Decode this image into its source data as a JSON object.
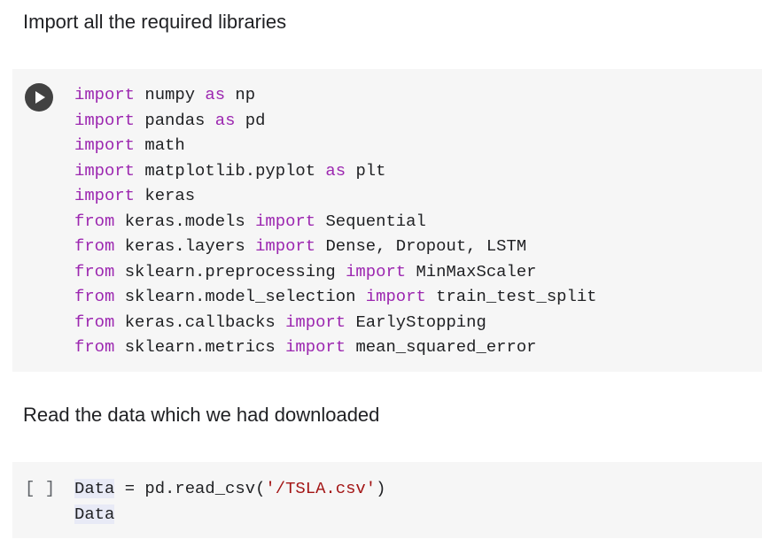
{
  "cells": {
    "text1": "Import all the required libraries",
    "code1": {
      "lines": [
        [
          {
            "t": "import",
            "k": "kw"
          },
          {
            "t": " numpy ",
            "k": "plain"
          },
          {
            "t": "as",
            "k": "kw"
          },
          {
            "t": " np",
            "k": "plain"
          }
        ],
        [
          {
            "t": "import",
            "k": "kw"
          },
          {
            "t": " pandas ",
            "k": "plain"
          },
          {
            "t": "as",
            "k": "kw"
          },
          {
            "t": " pd",
            "k": "plain"
          }
        ],
        [
          {
            "t": "import",
            "k": "kw"
          },
          {
            "t": " math",
            "k": "plain"
          }
        ],
        [
          {
            "t": "import",
            "k": "kw"
          },
          {
            "t": " matplotlib.pyplot ",
            "k": "plain"
          },
          {
            "t": "as",
            "k": "kw"
          },
          {
            "t": " plt",
            "k": "plain"
          }
        ],
        [
          {
            "t": "import",
            "k": "kw"
          },
          {
            "t": " keras",
            "k": "plain"
          }
        ],
        [
          {
            "t": "from",
            "k": "kw"
          },
          {
            "t": " keras.models ",
            "k": "plain"
          },
          {
            "t": "import",
            "k": "kw"
          },
          {
            "t": " Sequential",
            "k": "plain"
          }
        ],
        [
          {
            "t": "from",
            "k": "kw"
          },
          {
            "t": " keras.layers ",
            "k": "plain"
          },
          {
            "t": "import",
            "k": "kw"
          },
          {
            "t": " Dense, Dropout, LSTM",
            "k": "plain"
          }
        ],
        [
          {
            "t": "from",
            "k": "kw"
          },
          {
            "t": " sklearn.preprocessing ",
            "k": "plain"
          },
          {
            "t": "import",
            "k": "kw"
          },
          {
            "t": " MinMaxScaler",
            "k": "plain"
          }
        ],
        [
          {
            "t": "from",
            "k": "kw"
          },
          {
            "t": " sklearn.model_selection ",
            "k": "plain"
          },
          {
            "t": "import",
            "k": "kw"
          },
          {
            "t": " train_test_split",
            "k": "plain"
          }
        ],
        [
          {
            "t": "from",
            "k": "kw"
          },
          {
            "t": " keras.callbacks ",
            "k": "plain"
          },
          {
            "t": "import",
            "k": "kw"
          },
          {
            "t": " EarlyStopping",
            "k": "plain"
          }
        ],
        [
          {
            "t": "from",
            "k": "kw"
          },
          {
            "t": " sklearn.metrics ",
            "k": "plain"
          },
          {
            "t": "import",
            "k": "kw"
          },
          {
            "t": " mean_squared_error",
            "k": "plain"
          }
        ]
      ],
      "run_icon": "play-icon"
    },
    "text2": "Read the data which we had downloaded",
    "code2": {
      "exec_indicator": "[ ]",
      "lines": [
        [
          {
            "t": "Data",
            "k": "plain",
            "hl": true
          },
          {
            "t": " = pd.read_csv(",
            "k": "plain"
          },
          {
            "t": "'/TSLA.csv'",
            "k": "str"
          },
          {
            "t": ")",
            "k": "plain"
          }
        ],
        [
          {
            "t": "Data",
            "k": "plain",
            "hl": true
          }
        ]
      ]
    }
  },
  "colors": {
    "keyword": "#9c27b0",
    "string": "#a31515",
    "code_bg": "#f6f6f6",
    "text": "#202124"
  }
}
